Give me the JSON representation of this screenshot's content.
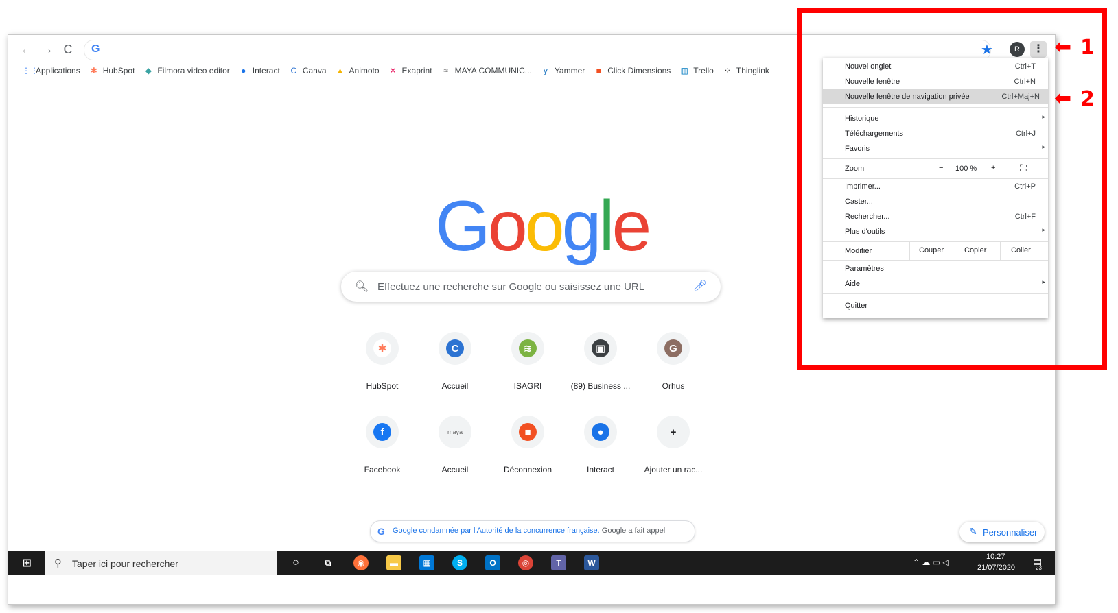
{
  "toolbar": {
    "back": "←",
    "forward": "→",
    "reload": "C",
    "omnibox_icon": "G",
    "star": "★",
    "avatar_letter": "R",
    "menu": "⋮"
  },
  "bookmarks": [
    {
      "label": "Applications",
      "icon": "grid-icon",
      "glyph": "⋮⋮",
      "color": "#4285f4"
    },
    {
      "label": "HubSpot",
      "icon": "hubspot-icon",
      "glyph": "✱",
      "color": "#ff7a59"
    },
    {
      "label": "Filmora video editor",
      "icon": "filmora-icon",
      "glyph": "◆",
      "color": "#3aa3a3"
    },
    {
      "label": "Interact",
      "icon": "interact-icon",
      "glyph": "●",
      "color": "#1a73e8"
    },
    {
      "label": "Canva",
      "icon": "canva-icon",
      "glyph": "C",
      "color": "#2c73d2"
    },
    {
      "label": "Animoto",
      "icon": "animoto-icon",
      "glyph": "▲",
      "color": "#f4b400"
    },
    {
      "label": "Exaprint",
      "icon": "exaprint-icon",
      "glyph": "✕",
      "color": "#e91e63"
    },
    {
      "label": "MAYA COMMUNIC...",
      "icon": "maya-icon",
      "glyph": "≈",
      "color": "#777777"
    },
    {
      "label": "Yammer",
      "icon": "yammer-icon",
      "glyph": "y",
      "color": "#106ebe"
    },
    {
      "label": "Click Dimensions",
      "icon": "microsoft-icon",
      "glyph": "■",
      "color": "#f25022"
    },
    {
      "label": "Trello",
      "icon": "trello-icon",
      "glyph": "▥",
      "color": "#0079bf"
    },
    {
      "label": "Thinglink",
      "icon": "thinglink-icon",
      "glyph": "⁘",
      "color": "#333333"
    }
  ],
  "logo": {
    "letters": [
      {
        "ch": "G",
        "color": "#4285f4"
      },
      {
        "ch": "o",
        "color": "#ea4335"
      },
      {
        "ch": "o",
        "color": "#fbbc05"
      },
      {
        "ch": "g",
        "color": "#4285f4"
      },
      {
        "ch": "l",
        "color": "#34a853"
      },
      {
        "ch": "e",
        "color": "#ea4335"
      }
    ]
  },
  "search": {
    "placeholder": "Effectuez une recherche sur Google ou saisissez une URL"
  },
  "shortcuts_row1": [
    {
      "label": "HubSpot",
      "glyph": "✱",
      "bg": "#ffffff",
      "fg": "#ff7a59",
      "icon": "hubspot-icon"
    },
    {
      "label": "Accueil",
      "glyph": "C",
      "bg": "#2c73d2",
      "fg": "#ffffff",
      "icon": "canva-icon"
    },
    {
      "label": "ISAGRI",
      "glyph": "≋",
      "bg": "#7cb342",
      "fg": "#ffffff",
      "icon": "isagri-icon"
    },
    {
      "label": "(89) Business ...",
      "glyph": "▣",
      "bg": "#3c4043",
      "fg": "#ffffff",
      "icon": "linkedin-page-icon"
    },
    {
      "label": "Orhus",
      "glyph": "G",
      "bg": "#8d6e63",
      "fg": "#ffffff",
      "icon": "letter-g-icon"
    }
  ],
  "shortcuts_row2": [
    {
      "label": "Facebook",
      "glyph": "f",
      "bg": "#1877f2",
      "fg": "#ffffff",
      "icon": "facebook-icon"
    },
    {
      "label": "Accueil",
      "glyph": "maya",
      "bg": "#f1f3f4",
      "fg": "#666666",
      "icon": "maya-icon"
    },
    {
      "label": "Déconnexion",
      "glyph": "■",
      "bg": "#f25022",
      "fg": "#ffffff",
      "icon": "microsoft-icon"
    },
    {
      "label": "Interact",
      "glyph": "●",
      "bg": "#1a73e8",
      "fg": "#ffffff",
      "icon": "interact-icon"
    },
    {
      "label": "Ajouter un rac...",
      "glyph": "+",
      "bg": "#f1f3f4",
      "fg": "#202124",
      "icon": "add-icon"
    }
  ],
  "news": {
    "link": "Google condamnée par l'Autorité de la concurrence française.",
    "rest": " Google a fait appel"
  },
  "customize": {
    "label": "Personnaliser"
  },
  "menu": {
    "nouvel_onglet": {
      "label": "Nouvel onglet",
      "shortcut": "Ctrl+T"
    },
    "nouvelle_fenetre": {
      "label": "Nouvelle fenêtre",
      "shortcut": "Ctrl+N"
    },
    "navigation_privee": {
      "label": "Nouvelle fenêtre de navigation privée",
      "shortcut": "Ctrl+Maj+N"
    },
    "historique": {
      "label": "Historique"
    },
    "telechargements": {
      "label": "Téléchargements",
      "shortcut": "Ctrl+J"
    },
    "favoris": {
      "label": "Favoris"
    },
    "zoom": {
      "label": "Zoom",
      "minus": "−",
      "value": "100 %",
      "plus": "+",
      "fullscreen": "⛶"
    },
    "imprimer": {
      "label": "Imprimer...",
      "shortcut": "Ctrl+P"
    },
    "caster": {
      "label": "Caster..."
    },
    "rechercher": {
      "label": "Rechercher...",
      "shortcut": "Ctrl+F"
    },
    "plus_outils": {
      "label": "Plus d'outils"
    },
    "modifier": {
      "label": "Modifier",
      "couper": "Couper",
      "copier": "Copier",
      "coller": "Coller"
    },
    "parametres": {
      "label": "Paramètres"
    },
    "aide": {
      "label": "Aide"
    },
    "quitter": {
      "label": "Quitter"
    }
  },
  "taskbar": {
    "search_placeholder": "Taper ici pour rechercher",
    "time": "10:27",
    "date": "21/07/2020",
    "notif_count": "23"
  },
  "annotations": {
    "label1": "1",
    "label2": "2",
    "color": "#ff0000"
  }
}
